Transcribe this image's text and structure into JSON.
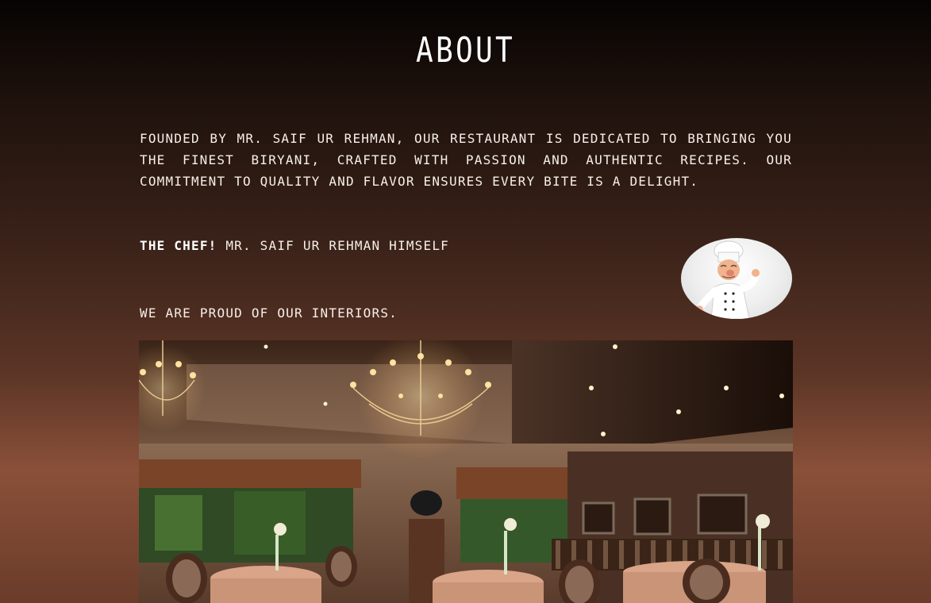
{
  "about": {
    "title": "About",
    "intro": "Founded by Mr. Saif ur Rehman, our restaurant is dedicated to bringing you the finest Biryani, crafted with passion and authentic recipes. Our commitment to quality and flavor ensures every bite is a delight.",
    "chef_label": "The Chef!",
    "chef_name": "Mr. Saif ur Rehman himself",
    "interiors_text": "We are proud of our interiors."
  },
  "images": {
    "chef_icon": "chef-cartoon",
    "interior_icon": "restaurant-interior-photo"
  }
}
